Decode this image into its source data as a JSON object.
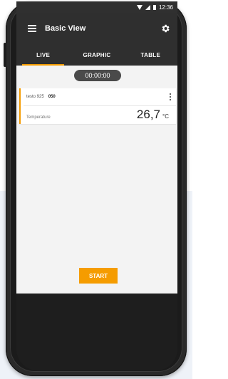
{
  "statusbar": {
    "time": "12:36"
  },
  "appbar": {
    "title": "Basic View",
    "menu_icon": "menu-icon",
    "settings_icon": "gear-icon"
  },
  "tabs": [
    {
      "label": "LIVE",
      "active": true
    },
    {
      "label": "GRAPHIC",
      "active": false
    },
    {
      "label": "TABLE",
      "active": false
    }
  ],
  "timer": "00:00:00",
  "card": {
    "device_name": "testo 925",
    "device_serial": "050",
    "measurement_label": "Temperature",
    "measurement_value": "26,7",
    "measurement_unit": "°C",
    "accent_color": "#f59c00"
  },
  "start_button": {
    "label": "START",
    "color": "#f59c00"
  }
}
